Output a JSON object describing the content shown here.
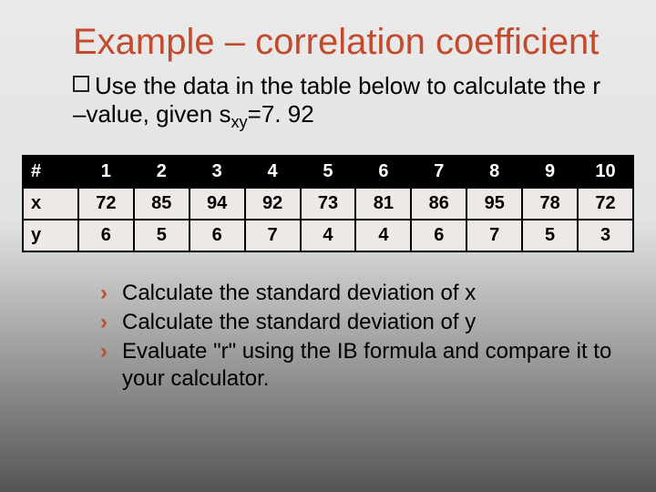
{
  "title": "Example – correlation coefficient",
  "body": {
    "pre": "Use the data in the table below to calculate the r –value, given s",
    "sub": "xy",
    "post": "=7. 92"
  },
  "table": {
    "header_label": "#",
    "cols": [
      "1",
      "2",
      "3",
      "4",
      "5",
      "6",
      "7",
      "8",
      "9",
      "10"
    ],
    "rows": [
      {
        "label": "x",
        "values": [
          "72",
          "85",
          "94",
          "92",
          "73",
          "81",
          "86",
          "95",
          "78",
          "72"
        ]
      },
      {
        "label": "y",
        "values": [
          "6",
          "5",
          "6",
          "7",
          "4",
          "4",
          "6",
          "7",
          "5",
          "3"
        ]
      }
    ]
  },
  "sublist": [
    "Calculate the standard deviation of x",
    "Calculate the standard deviation of y",
    "Evaluate \"r\" using the IB formula and compare it to your calculator."
  ],
  "chart_data": {
    "type": "table",
    "title": "Example – correlation coefficient",
    "note": "s_xy = 7.92",
    "columns": [
      "#",
      "1",
      "2",
      "3",
      "4",
      "5",
      "6",
      "7",
      "8",
      "9",
      "10"
    ],
    "rows": [
      [
        "x",
        72,
        85,
        94,
        92,
        73,
        81,
        86,
        95,
        78,
        72
      ],
      [
        "y",
        6,
        5,
        6,
        7,
        4,
        4,
        6,
        7,
        5,
        3
      ]
    ]
  }
}
